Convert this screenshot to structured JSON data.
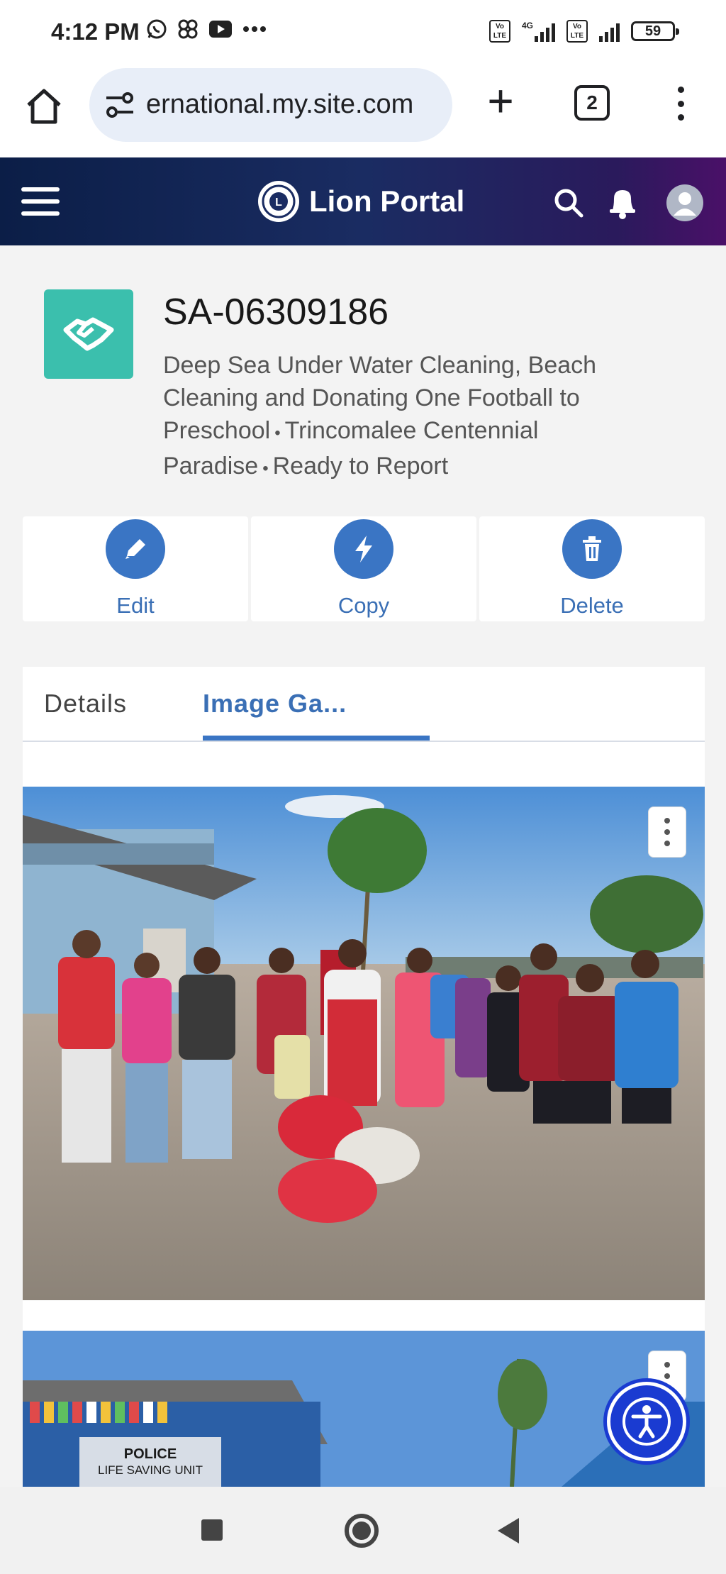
{
  "status_bar": {
    "time": "4:12 PM",
    "left_icons": [
      "whatsapp-icon",
      "pinwheel-icon",
      "youtube-icon",
      "more-dots-icon"
    ],
    "volte_1": "Vo LTE",
    "network_type": "4G",
    "volte_2": "Vo LTE",
    "battery": "59"
  },
  "browser": {
    "url": "ernational.my.site.com",
    "tab_count": "2"
  },
  "portal": {
    "title": "Lion Portal"
  },
  "record": {
    "id": "SA-06309186",
    "name": "Deep Sea Under Water Cleaning, Beach Cleaning and Donating One Football to Preschool",
    "club": "Trincomalee Centennial Paradise",
    "status": "Ready to Report"
  },
  "actions": {
    "edit": "Edit",
    "copy": "Copy",
    "delete": "Delete"
  },
  "tabs": {
    "details": "Details",
    "gallery": "Image Ga..."
  },
  "photo_2": {
    "sign_1": "POLICE",
    "sign_2": "LIFE SAVING UNIT"
  },
  "colors": {
    "accent": "#3a75c4",
    "record_icon": "#3bbfad",
    "header_start": "#0b1e47",
    "header_end": "#4a1068"
  }
}
